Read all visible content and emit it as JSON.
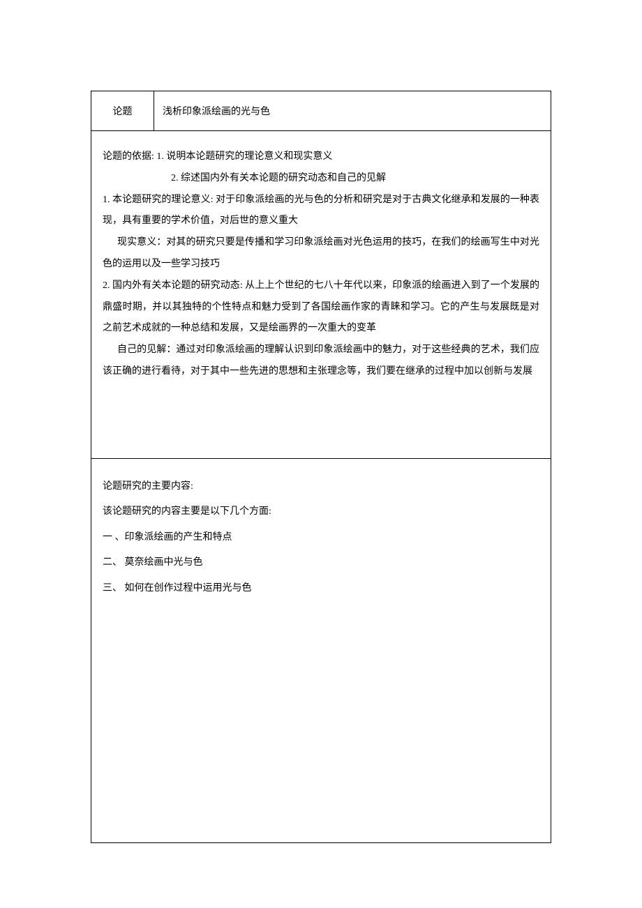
{
  "titleRow": {
    "label": "论题",
    "content": "浅析印象派绘画的光与色"
  },
  "basis": {
    "heading1": "论题的依据: 1. 说明本论题研究的理论意义和现实意义",
    "heading2": "2. 综述国内外有关本论题的研究动态和自己的见解",
    "p1": "1. 本论题研究的理论意义: 对于印象派绘画的光与色的分析和研究是对于古典文化继承和发展的一种表现，具有重要的学术价值，对后世的意义重大",
    "p2": "现实意义：对其的研究只要是传播和学习印象派绘画对光色运用的技巧，在我们的绘画写生中对光色的运用以及一些学习技巧",
    "p3": "2. 国内外有关本论题的研究动态: 从上上个世纪的七八十年代以来，印象派的绘画进入到了一个发展的鼎盛时期，并以其独特的个性特点和魅力受到了各国绘画作家的青睐和学习。它的产生与发展既是对之前艺术成就的一种总结和发展，又是绘画界的一次重大的变革",
    "p4": "自己的见解：通过对印象派绘画的理解认识到印象派绘画中的魅力，对于这些经典的艺术，我们应该正确的进行看待，对于其中一些先进的思想和主张理念等，我们要在继承的过程中加以创新与发展"
  },
  "contentSection": {
    "heading": "论题研究的主要内容:",
    "intro": "该论题研究的内容主要是以下几个方面:",
    "item1": "一 、印象派绘画的产生和特点",
    "item2": "二、 莫奈绘画中光与色",
    "item3": "三、 如何在创作过程中运用光与色"
  }
}
